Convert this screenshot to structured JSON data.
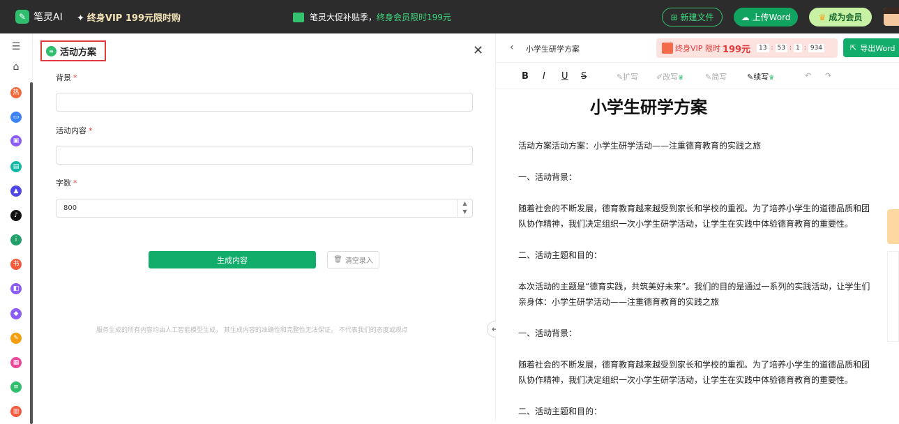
{
  "topbar": {
    "app_name": "笔灵AI",
    "vip_promo": "终身VIP 199元限时购",
    "center_promo_prefix": "笔灵大促补贴季，",
    "center_promo_highlight": "终身会员限时199元",
    "new_file": "新建文件",
    "upload_word": "上传Word",
    "become_member": "成为会员"
  },
  "sidebar": {
    "icons": [
      "menu-icon",
      "home-icon",
      "hot-icon",
      "briefcase-icon",
      "doc-icon",
      "image-icon",
      "graduation-icon",
      "tiktok-icon",
      "bottle-icon",
      "xiaohongshu-icon",
      "book-icon",
      "tag-icon",
      "pen-icon",
      "cube-icon",
      "file-icon",
      "chart-icon"
    ],
    "colors": [
      "#555555",
      "#555555",
      "#f06a3c",
      "#3b82f6",
      "#8b5cf6",
      "#14b8a6",
      "#4f46e5",
      "#111111",
      "#22a06b",
      "#f45a3c",
      "#8b5cf6",
      "#8b5cf6",
      "#f59e0b",
      "#ec4899",
      "#2fbd6e",
      "#f45a3c"
    ]
  },
  "form": {
    "title": "活动方案",
    "fields": [
      {
        "label": "背景",
        "value": "",
        "placeholder": ""
      },
      {
        "label": "活动内容",
        "value": "",
        "placeholder": ""
      },
      {
        "label": "字数",
        "value": "800",
        "placeholder": ""
      }
    ],
    "generate": "生成内容",
    "clear": "清空录入",
    "disclaimer": "服务生成的所有内容均由人工智能模型生成， 其生成内容的准确性和完整性无法保证， 不代表我们的态度或观点"
  },
  "doc": {
    "name": "小学生研学方案",
    "vip_label": "终身VIP 限时",
    "vip_price": "199元",
    "timer": [
      "13",
      "53",
      "1",
      "934"
    ],
    "export": "导出Word",
    "toolbar": {
      "bold": "B",
      "italic": "I",
      "underline": "U",
      "strike": "S",
      "expand": "扩写",
      "rewrite": "改写",
      "shorten": "简写",
      "continue": "续写"
    },
    "title": "小学生研学方案",
    "paragraphs": [
      "活动方案活动方案：小学生研学活动——注重德育教育的实践之旅",
      "一、活动背景：",
      "随着社会的不断发展，德育教育越来越受到家长和学校的重视。为了培养小学生的道德品质和团",
      "队协作精神，我们决定组织一次小学生研学活动，让学生在实践中体验德育教育的重要性。",
      "二、活动主题和目的：",
      "本次活动的主题是“德育实践，共筑美好未来”。我们的目的是通过一系列的实践活动，让学生们",
      "亲身体：小学生研学活动——注重德育教育的实践之旅",
      "一、活动背景：",
      "随着社会的不断发展，德育教育越来越受到家长和学校的重视。为了培养小学生的道德品质和团",
      "队协作精神，我们决定组织一次小学生研学活动，让学生在实践中体验德育教育的重要性。",
      "二、活动主题和目的："
    ]
  }
}
